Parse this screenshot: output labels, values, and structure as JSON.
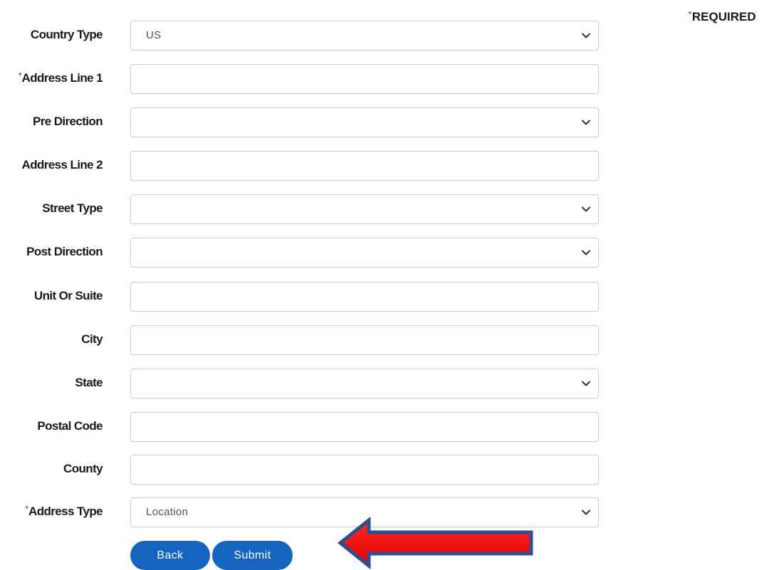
{
  "required_note": {
    "asterisk": "*",
    "label": "REQUIRED"
  },
  "icons": {
    "dropdown": "chevron-down-icon",
    "annotation": "red-arrow-left"
  },
  "colors": {
    "required_asterisk": "#d9230f",
    "button_bg": "#1565c0",
    "arrow_fill": "#ee1111",
    "arrow_outline": "#2f4f8f"
  },
  "form": {
    "fields": [
      {
        "label": "Country Type",
        "required": false,
        "type": "select",
        "value": "US"
      },
      {
        "label": "Address Line 1",
        "required": true,
        "type": "text",
        "value": ""
      },
      {
        "label": "Pre Direction",
        "required": false,
        "type": "select",
        "value": ""
      },
      {
        "label": "Address Line 2",
        "required": false,
        "type": "text",
        "value": ""
      },
      {
        "label": "Street Type",
        "required": false,
        "type": "select",
        "value": ""
      },
      {
        "label": "Post Direction",
        "required": false,
        "type": "select",
        "value": ""
      },
      {
        "label": "Unit Or Suite",
        "required": false,
        "type": "text",
        "value": ""
      },
      {
        "label": "City",
        "required": false,
        "type": "text",
        "value": ""
      },
      {
        "label": "State",
        "required": false,
        "type": "select",
        "value": ""
      },
      {
        "label": "Postal Code",
        "required": false,
        "type": "text",
        "value": ""
      },
      {
        "label": "County",
        "required": false,
        "type": "text",
        "value": ""
      },
      {
        "label": "Address Type",
        "required": true,
        "type": "select",
        "value": "Location"
      }
    ]
  },
  "buttons": {
    "back_label": "Back",
    "submit_label": "Submit"
  }
}
